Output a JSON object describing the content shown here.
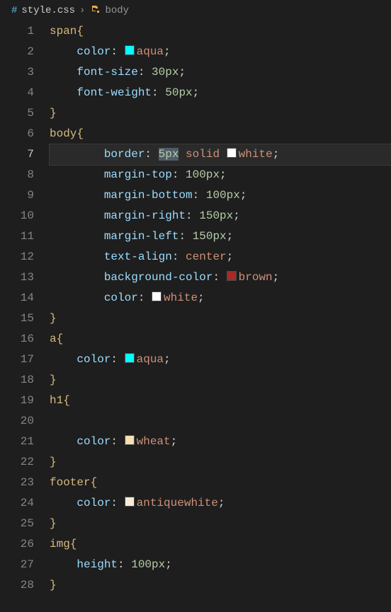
{
  "breadcrumb": {
    "file_icon": "#",
    "file_name": "style.css",
    "separator": "›",
    "symbol_name": "body"
  },
  "active_line": 7,
  "lines": [
    {
      "n": 1,
      "indent": 0,
      "kind": "selector-open",
      "selector": "span"
    },
    {
      "n": 2,
      "indent": 1,
      "kind": "decl-color",
      "prop": "color",
      "swatch": "#00ffff",
      "value": "aqua"
    },
    {
      "n": 3,
      "indent": 1,
      "kind": "decl",
      "prop": "font-size",
      "value_num": "30",
      "value_unit": "px"
    },
    {
      "n": 4,
      "indent": 1,
      "kind": "decl",
      "prop": "font-weight",
      "value_num": "50",
      "value_unit": "px"
    },
    {
      "n": 5,
      "indent": 0,
      "kind": "close"
    },
    {
      "n": 6,
      "indent": 0,
      "kind": "selector-open",
      "selector": "body"
    },
    {
      "n": 7,
      "indent": 2,
      "kind": "decl-border",
      "prop": "border",
      "size_num": "5",
      "size_unit": "px",
      "style": "solid",
      "swatch": "#ffffff",
      "color": "white",
      "highlight_size": true
    },
    {
      "n": 8,
      "indent": 2,
      "kind": "decl",
      "prop": "margin-top",
      "value_num": "100",
      "value_unit": "px"
    },
    {
      "n": 9,
      "indent": 2,
      "kind": "decl",
      "prop": "margin-bottom",
      "value_num": "100",
      "value_unit": "px"
    },
    {
      "n": 10,
      "indent": 2,
      "kind": "decl",
      "prop": "margin-right",
      "value_num": "150",
      "value_unit": "px"
    },
    {
      "n": 11,
      "indent": 2,
      "kind": "decl",
      "prop": "margin-left",
      "value_num": "150",
      "value_unit": "px"
    },
    {
      "n": 12,
      "indent": 2,
      "kind": "decl-ident",
      "prop": "text-align",
      "value": "center"
    },
    {
      "n": 13,
      "indent": 2,
      "kind": "decl-color",
      "prop": "background-color",
      "swatch": "#a52a2a",
      "value": "brown"
    },
    {
      "n": 14,
      "indent": 2,
      "kind": "decl-color",
      "prop": "color",
      "swatch": "#ffffff",
      "value": "white"
    },
    {
      "n": 15,
      "indent": 0,
      "kind": "close"
    },
    {
      "n": 16,
      "indent": 0,
      "kind": "selector-open",
      "selector": "a"
    },
    {
      "n": 17,
      "indent": 1,
      "kind": "decl-color",
      "prop": "color",
      "swatch": "#00ffff",
      "value": "aqua"
    },
    {
      "n": 18,
      "indent": 0,
      "kind": "close"
    },
    {
      "n": 19,
      "indent": 0,
      "kind": "selector-open",
      "selector": "h1"
    },
    {
      "n": 20,
      "indent": 0,
      "kind": "blank"
    },
    {
      "n": 21,
      "indent": 1,
      "kind": "decl-color",
      "prop": "color",
      "swatch": "#f5deb3",
      "value": "wheat"
    },
    {
      "n": 22,
      "indent": 0,
      "kind": "close"
    },
    {
      "n": 23,
      "indent": 0,
      "kind": "selector-open",
      "selector": "footer"
    },
    {
      "n": 24,
      "indent": 1,
      "kind": "decl-color",
      "prop": "color",
      "swatch": "#faebd7",
      "value": "antiquewhite"
    },
    {
      "n": 25,
      "indent": 0,
      "kind": "close"
    },
    {
      "n": 26,
      "indent": 0,
      "kind": "selector-open",
      "selector": "img"
    },
    {
      "n": 27,
      "indent": 1,
      "kind": "decl",
      "prop": "height",
      "value_num": "100",
      "value_unit": "px"
    },
    {
      "n": 28,
      "indent": 0,
      "kind": "close"
    }
  ]
}
